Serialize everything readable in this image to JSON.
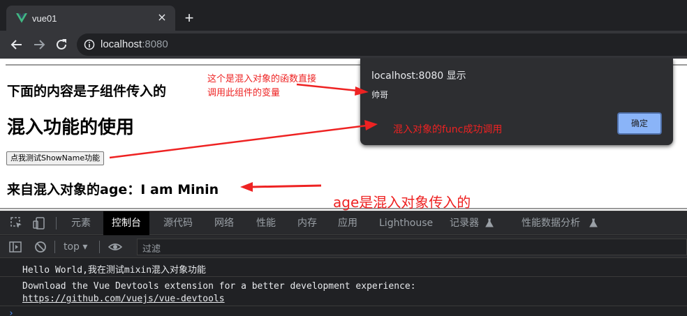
{
  "browser": {
    "tab_title": "vue01",
    "tab_close": "×",
    "new_tab": "+",
    "url_host": "localhost",
    "url_port": ":8080"
  },
  "page": {
    "heading_sub": "下面的内容是子组件传入的",
    "heading_main": "混入功能的使用",
    "test_button_label": "点我测试ShowName功能",
    "age_text": "来自混入对象的age：I am Minin"
  },
  "dialog": {
    "title": "localhost:8080 显示",
    "message": "帅哥",
    "ok_label": "确定"
  },
  "annotations": {
    "note_func_line1": "这个是混入对象的函数直接",
    "note_func_line2": "调用此组件的变量",
    "note_func_success": "混入对象的func成功调用",
    "note_age": "age是混入对象传入的",
    "color": "#ee2222"
  },
  "devtools": {
    "tabs": [
      "元素",
      "控制台",
      "源代码",
      "网络",
      "性能",
      "内存",
      "应用",
      "Lighthouse",
      "记录器",
      "性能数据分析"
    ],
    "active_tab": "控制台",
    "context": "top",
    "filter_placeholder": "过滤",
    "console": {
      "line1": "Hello World,我在测试mixin混入对象功能",
      "line2": "Download the Vue Devtools extension for a better development experience:",
      "line2_link": "https://github.com/vuejs/vue-devtools",
      "prompt": "›"
    }
  }
}
